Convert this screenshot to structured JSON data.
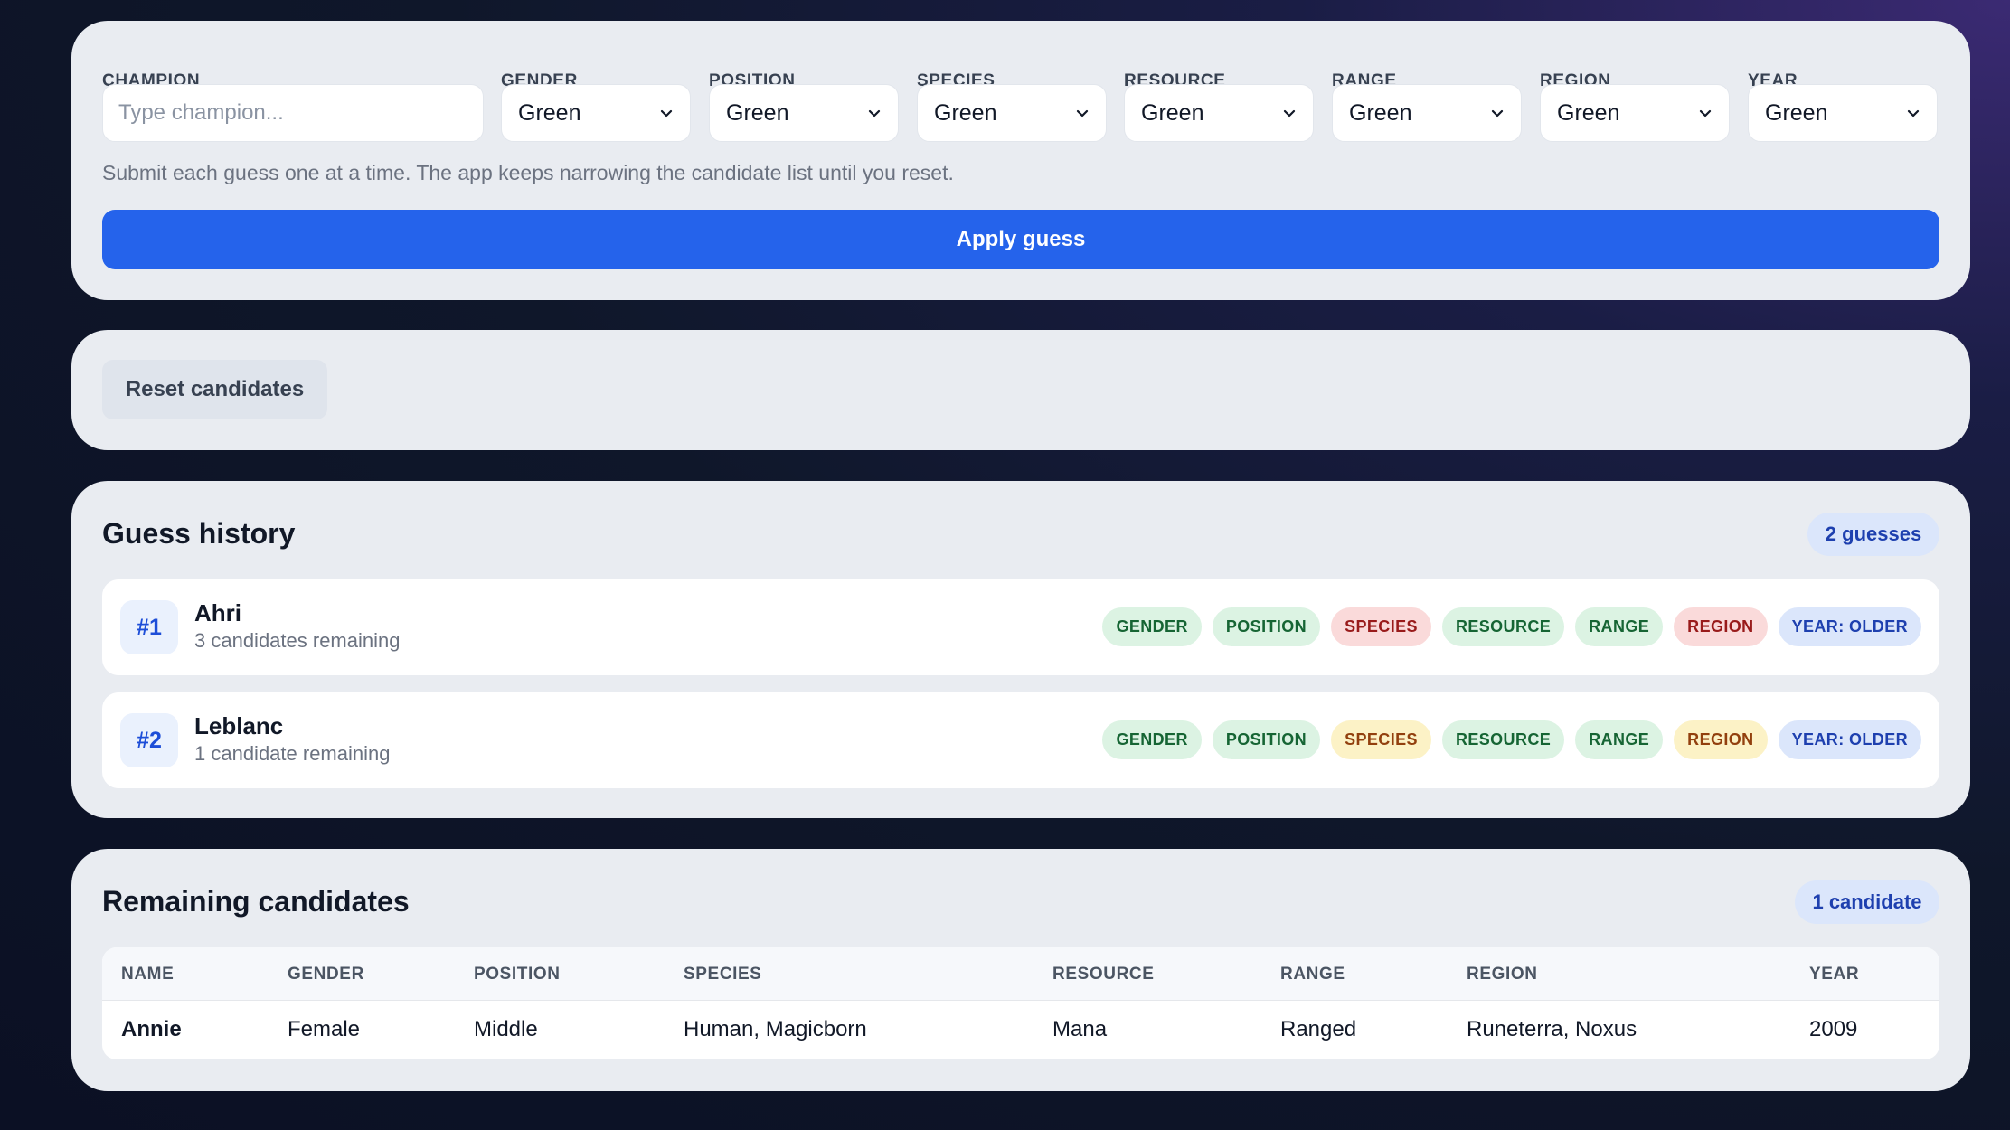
{
  "form": {
    "champion_label": "CHAMPION",
    "champion_placeholder": "Type champion...",
    "fields": [
      {
        "label": "GENDER",
        "value": "Green"
      },
      {
        "label": "POSITION",
        "value": "Green"
      },
      {
        "label": "SPECIES",
        "value": "Green"
      },
      {
        "label": "RESOURCE",
        "value": "Green"
      },
      {
        "label": "RANGE",
        "value": "Green"
      },
      {
        "label": "REGION",
        "value": "Green"
      },
      {
        "label": "YEAR",
        "value": "Green"
      }
    ],
    "hint": "Submit each guess one at a time. The app keeps narrowing the candidate list until you reset.",
    "apply_label": "Apply guess"
  },
  "reset": {
    "label": "Reset candidates"
  },
  "history": {
    "title": "Guess history",
    "count": "2 guesses",
    "guesses": [
      {
        "num": "#1",
        "name": "Ahri",
        "remaining": "3 candidates remaining",
        "tags": [
          {
            "label": "GENDER",
            "status": "green"
          },
          {
            "label": "POSITION",
            "status": "green"
          },
          {
            "label": "SPECIES",
            "status": "red"
          },
          {
            "label": "RESOURCE",
            "status": "green"
          },
          {
            "label": "RANGE",
            "status": "green"
          },
          {
            "label": "REGION",
            "status": "red"
          },
          {
            "label": "YEAR: OLDER",
            "status": "blue"
          }
        ]
      },
      {
        "num": "#2",
        "name": "Leblanc",
        "remaining": "1 candidate remaining",
        "tags": [
          {
            "label": "GENDER",
            "status": "green"
          },
          {
            "label": "POSITION",
            "status": "green"
          },
          {
            "label": "SPECIES",
            "status": "yellow"
          },
          {
            "label": "RESOURCE",
            "status": "green"
          },
          {
            "label": "RANGE",
            "status": "green"
          },
          {
            "label": "REGION",
            "status": "yellow"
          },
          {
            "label": "YEAR: OLDER",
            "status": "blue"
          }
        ]
      }
    ]
  },
  "remaining": {
    "title": "Remaining candidates",
    "count": "1 candidate",
    "columns": [
      "NAME",
      "GENDER",
      "POSITION",
      "SPECIES",
      "RESOURCE",
      "RANGE",
      "REGION",
      "YEAR"
    ],
    "rows": [
      [
        "Annie",
        "Female",
        "Middle",
        "Human, Magicborn",
        "Mana",
        "Ranged",
        "Runeterra, Noxus",
        "2009"
      ]
    ]
  },
  "colors": {
    "accent": "#2563eb",
    "green": "#166534",
    "red": "#991b1b",
    "yellow": "#92400e",
    "blue": "#1e40af"
  },
  "icons": {
    "select_arrow": "chevron-down-icon"
  }
}
